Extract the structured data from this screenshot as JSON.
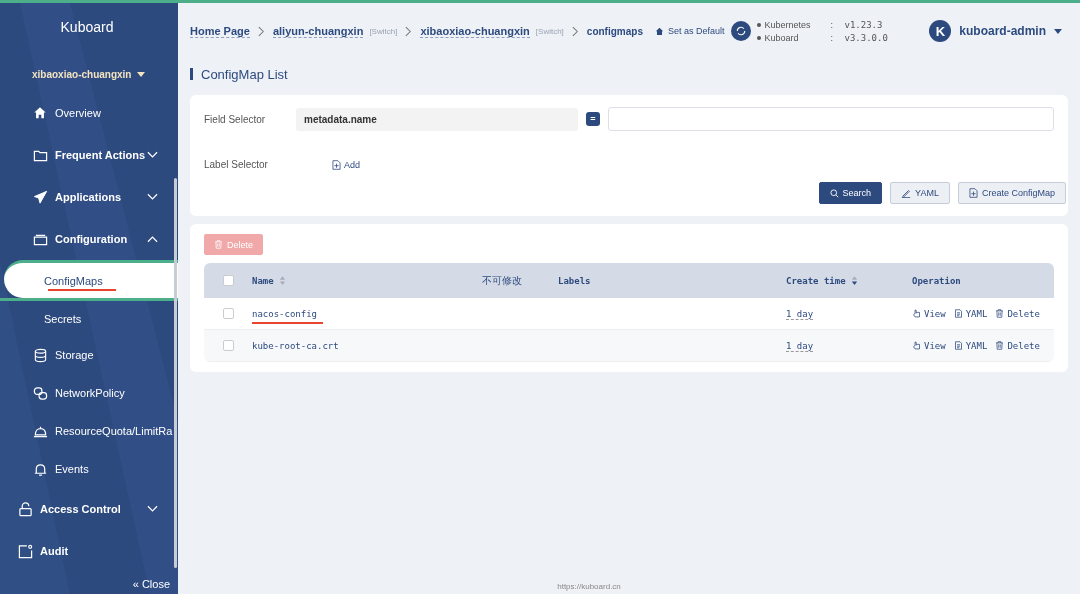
{
  "sidebar": {
    "title": "Kuboard",
    "namespace": "xibaoxiao-chuangxin",
    "items": [
      {
        "label": "Overview",
        "kind": "main",
        "selected": false
      },
      {
        "label": "Frequent Actions",
        "kind": "main",
        "selected": false,
        "expanded": false
      },
      {
        "label": "Applications",
        "kind": "main",
        "selected": false,
        "expanded": false
      },
      {
        "label": "Configuration",
        "kind": "main",
        "selected": false,
        "expanded": true,
        "children": [
          {
            "label": "ConfigMaps",
            "kind": "page",
            "selected": true
          },
          {
            "label": "Secrets",
            "kind": "page",
            "selected": false
          },
          {
            "label": "Storage",
            "kind": "module",
            "selected": false
          },
          {
            "label": "NetworkPolicy",
            "kind": "module",
            "selected": false
          },
          {
            "label": "ResourceQuota/LimitRa",
            "kind": "module",
            "selected": false
          },
          {
            "label": "Events",
            "kind": "module",
            "selected": false
          }
        ]
      },
      {
        "label": "Access Control",
        "kind": "global",
        "selected": false,
        "expanded": false
      },
      {
        "label": "Audit",
        "kind": "global",
        "selected": false
      }
    ],
    "close": "« Close"
  },
  "breadcrumb": [
    {
      "label": "Home Page",
      "current": false
    },
    {
      "label": "aliyun-chuangxin",
      "switch": "[Switch]",
      "current": false
    },
    {
      "label": "xibaoxiao-chuangxin",
      "switch": "[Switch]",
      "current": false
    },
    {
      "label": "configmaps",
      "current": true
    }
  ],
  "set_default": "Set as Default",
  "versions": [
    {
      "name": "Kubernetes",
      "separator": ":",
      "value": "v1.23.3"
    },
    {
      "name": "Kuboard",
      "separator": ":",
      "value": "v3.3.0.0"
    }
  ],
  "user": {
    "avatar": "K",
    "name": "kuboard-admin"
  },
  "page_title": "ConfigMap List",
  "filter": {
    "field_label": "Field Selector",
    "field_name": "metadata.name",
    "operator": "=",
    "label_label": "Label Selector",
    "add": "Add",
    "buttons": [
      {
        "label": "Search",
        "kind": "primary"
      },
      {
        "label": "YAML",
        "kind": "yaml"
      },
      {
        "label": "Create ConfigMap",
        "kind": "create"
      }
    ]
  },
  "table": {
    "delete_button": {
      "label": "Delete",
      "disabled": true
    },
    "columns": [
      {
        "label": "Name",
        "sortable": true,
        "sort_desc": false
      },
      {
        "label": "不可修改",
        "sortable": false
      },
      {
        "label": "Labels",
        "sortable": false
      },
      {
        "label": "Create time",
        "sortable": true,
        "sort_desc": true
      },
      {
        "label": "Operation",
        "sortable": false
      }
    ],
    "header_checked": false,
    "rows": [
      {
        "name": "nacos-config",
        "time": "1 day",
        "checked": false,
        "highlighted": true,
        "actions": [
          "View",
          "YAML",
          "Delete"
        ]
      },
      {
        "name": "kube-root-ca.crt",
        "time": "1 day",
        "checked": false,
        "highlighted": false,
        "actions": [
          "View",
          "YAML",
          "Delete"
        ]
      }
    ]
  },
  "footer": "https://kuboard.cn"
}
